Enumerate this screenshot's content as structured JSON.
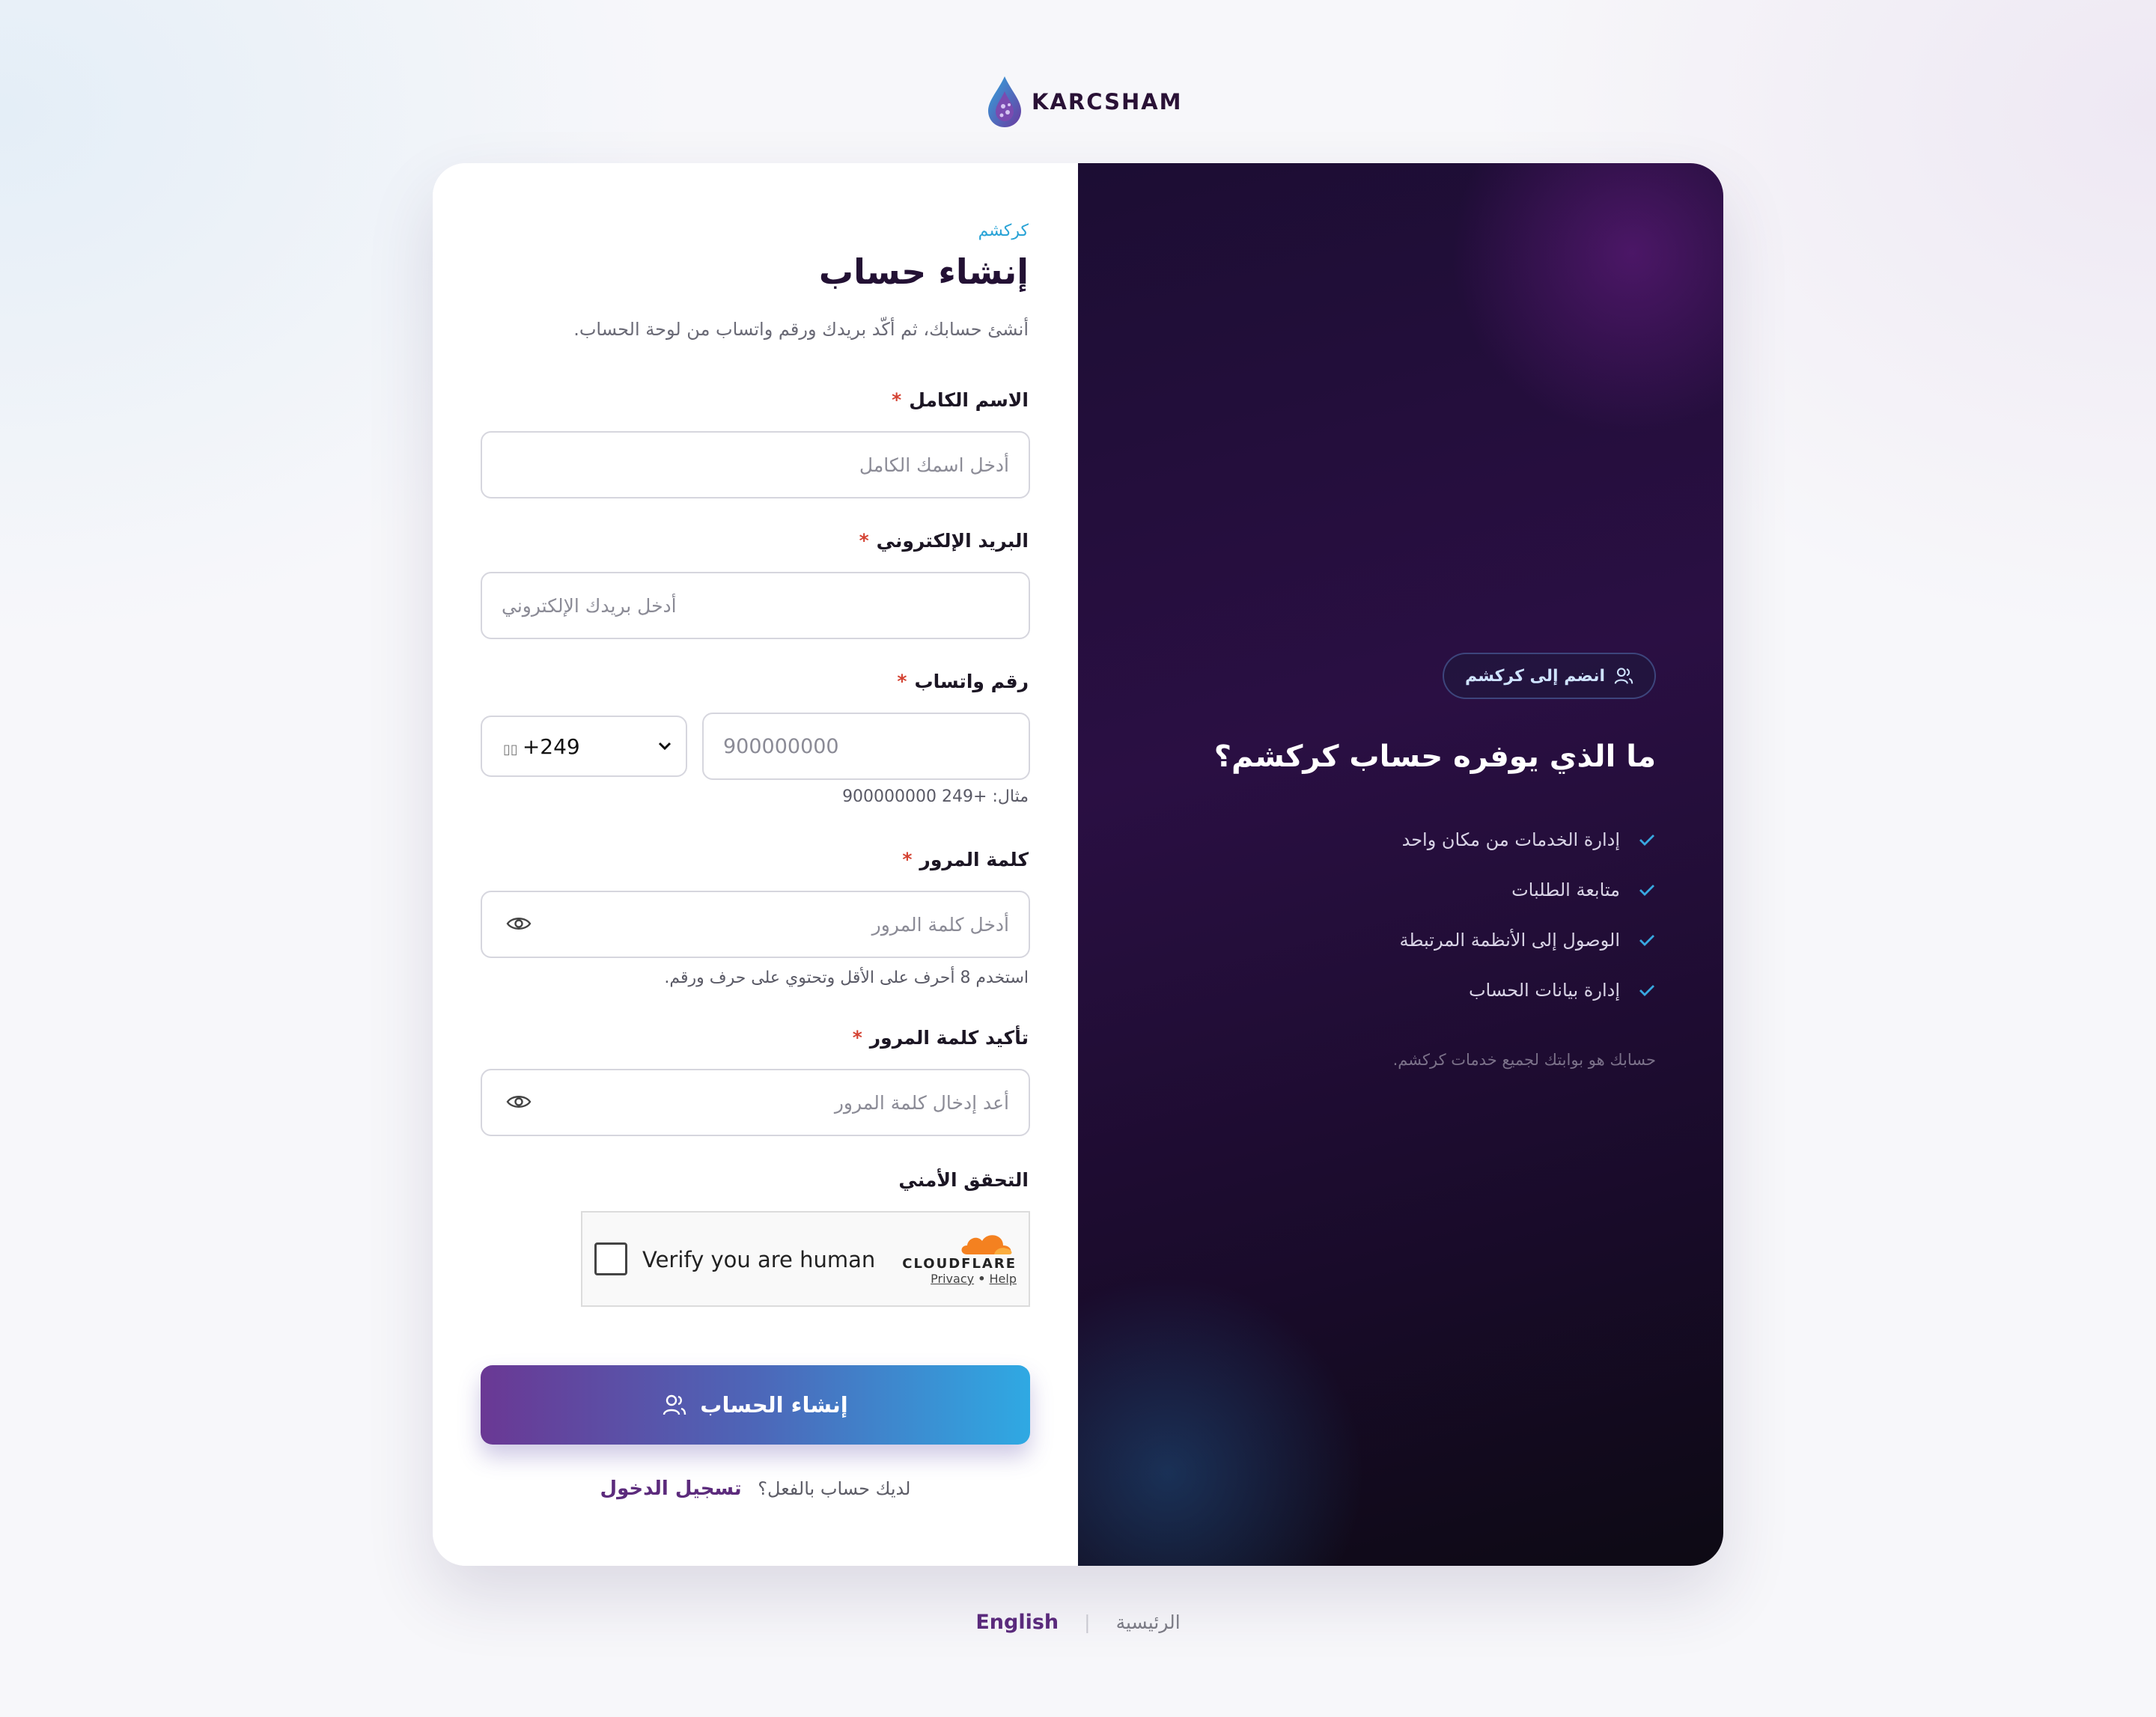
{
  "brand": {
    "logo_text": "KARCSHAM"
  },
  "form": {
    "brand_tag": "كركشم",
    "title": "إنشاء حساب",
    "subtitle": "أنشئ حسابك، ثم أكّد بريدك ورقم واتساب من لوحة الحساب.",
    "required_mark": "*",
    "full_name": {
      "label": "الاسم الكامل",
      "placeholder": "أدخل اسمك الكامل"
    },
    "email": {
      "label": "البريد الإلكتروني",
      "placeholder": "أدخل بريدك الإلكتروني"
    },
    "whatsapp": {
      "label": "رقم واتساب",
      "placeholder": "900000000",
      "country_code": "+249",
      "hint": "مثال: +249 900000000"
    },
    "password": {
      "label": "كلمة المرور",
      "placeholder": "أدخل كلمة المرور",
      "hint": "استخدم 8 أحرف على الأقل وتحتوي على حرف ورقم."
    },
    "confirm_password": {
      "label": "تأكيد كلمة المرور",
      "placeholder": "أعد إدخال كلمة المرور"
    },
    "security_label": "التحقق الأمني",
    "captcha": {
      "text": "Verify you are human",
      "provider": "CLOUDFLARE",
      "privacy": "Privacy",
      "dot": "•",
      "help": "Help"
    },
    "submit_label": "إنشاء الحساب",
    "have_account": "لديك حساب بالفعل؟",
    "login_link": "تسجيل الدخول"
  },
  "promo": {
    "pill": "انضم إلى كركشم",
    "title": "ما الذي يوفره حساب كركشم؟",
    "items": [
      "إدارة الخدمات من مكان واحد",
      "متابعة الطلبات",
      "الوصول إلى الأنظمة المرتبطة",
      "إدارة بيانات الحساب"
    ],
    "note": "حسابك هو بوابتك لجميع خدمات كركشم."
  },
  "footer": {
    "english": "English",
    "separator": "|",
    "home": "الرئيسية"
  },
  "colors": {
    "accent_purple": "#5c2b7c",
    "accent_blue": "#29a3d6",
    "required": "#d44232",
    "promo_bg": "#1c0d33"
  }
}
